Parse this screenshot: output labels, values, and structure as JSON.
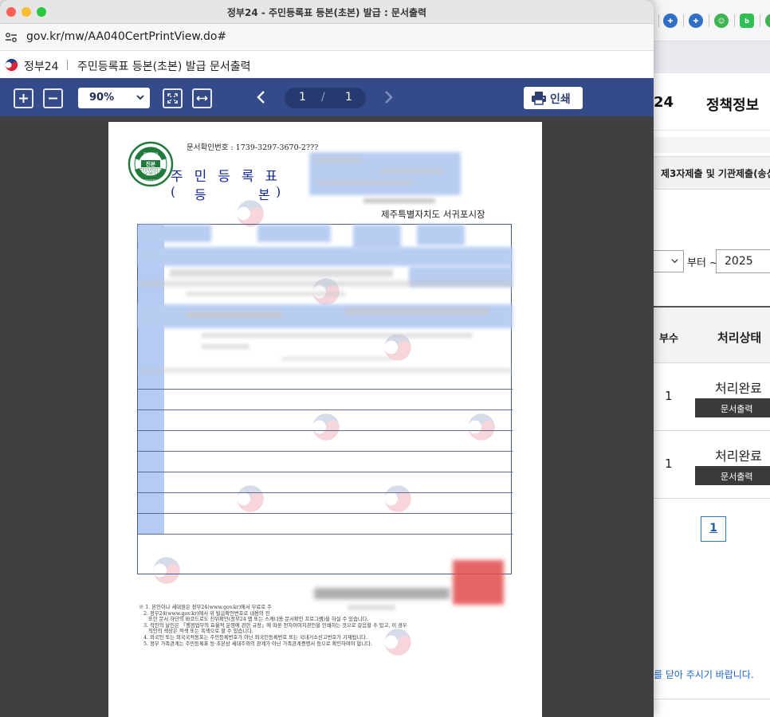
{
  "window": {
    "title": "정부24 - 주민등록표 등본(초본) 발급 : 문서출력"
  },
  "address_bar": {
    "url": "gov.kr/mw/AA040CertPrintView.do#"
  },
  "header": {
    "site_name": "정부24",
    "page_heading": "주민등록표 등본(초본) 발급 문서출력"
  },
  "viewer_toolbar": {
    "zoom": "90%",
    "page_current": "1",
    "page_separator": "/",
    "page_total": "1",
    "print_label": "인쇄"
  },
  "document": {
    "confirm_number": "문서확인번호 : 1739-3297-3670-2???",
    "title": "주민등록표",
    "subtitle_chars": [
      "(",
      "등",
      "본",
      ")"
    ],
    "issuer": "제주특별자치도 서귀포시장",
    "stamp": {
      "top": "진본확인",
      "middle": "진본",
      "date": "2025/02/12",
      "time": "12:08:57",
      "zone": "KST",
      "bottom": "행정안전부"
    },
    "notes": "※ 1. 본인이나 세대원은 정부24(www.gov.kr)에서 무료로 주\n   2. 정부24(www.gov.kr)에서 위 발급확인번호로 내용의 진\n      또한 문서 하단의 바코드로도 진위확인(정부24 앱 또는 스캐너용 문서확인 프로그램)을 하실 수 있습니다.\n   3. 직인의 날인은 「행정업무의 효율적 운영에 관한 규정」에 따른 전자이미지관인을 인쇄하는 것으로 갈음할 수 있고, 이 경우\n      직인의 색상은 적색 또는 흑색으로 할 수 있습니다.\n   4. 외국인 또는 외국국적동포는 주민등록번호가 아닌 외국인등록번호 또는 국내거소신고번호가 기재됩니다.\n   5. 정부 가족관계는 주민등록표 등·초본상 세대주와의 관계가 아닌 가족관계증명서 등으로 확인하여야 합니다."
  },
  "background_page": {
    "nav_item_partial": "24",
    "nav_policy": "정책정보",
    "tab_label": "제3자제출 및 기관제출(송신)",
    "date_from_label": "부터 ~",
    "year": "2025",
    "col_copies": "부수",
    "col_status": "처리상태",
    "rows": [
      {
        "copies": "1",
        "status": "처리완료",
        "button": "문서출력"
      },
      {
        "copies": "1",
        "status": "처리완료",
        "button": "문서출력"
      }
    ],
    "pager_current": "1",
    "notice_partial": "를 닫아 주시기 바랍니다."
  },
  "colors": {
    "toolbar_blue": "#344a89",
    "doc_title_blue": "#15289a",
    "stamp_green": "#1f7a3c",
    "notice_blue": "#1e64c8"
  }
}
